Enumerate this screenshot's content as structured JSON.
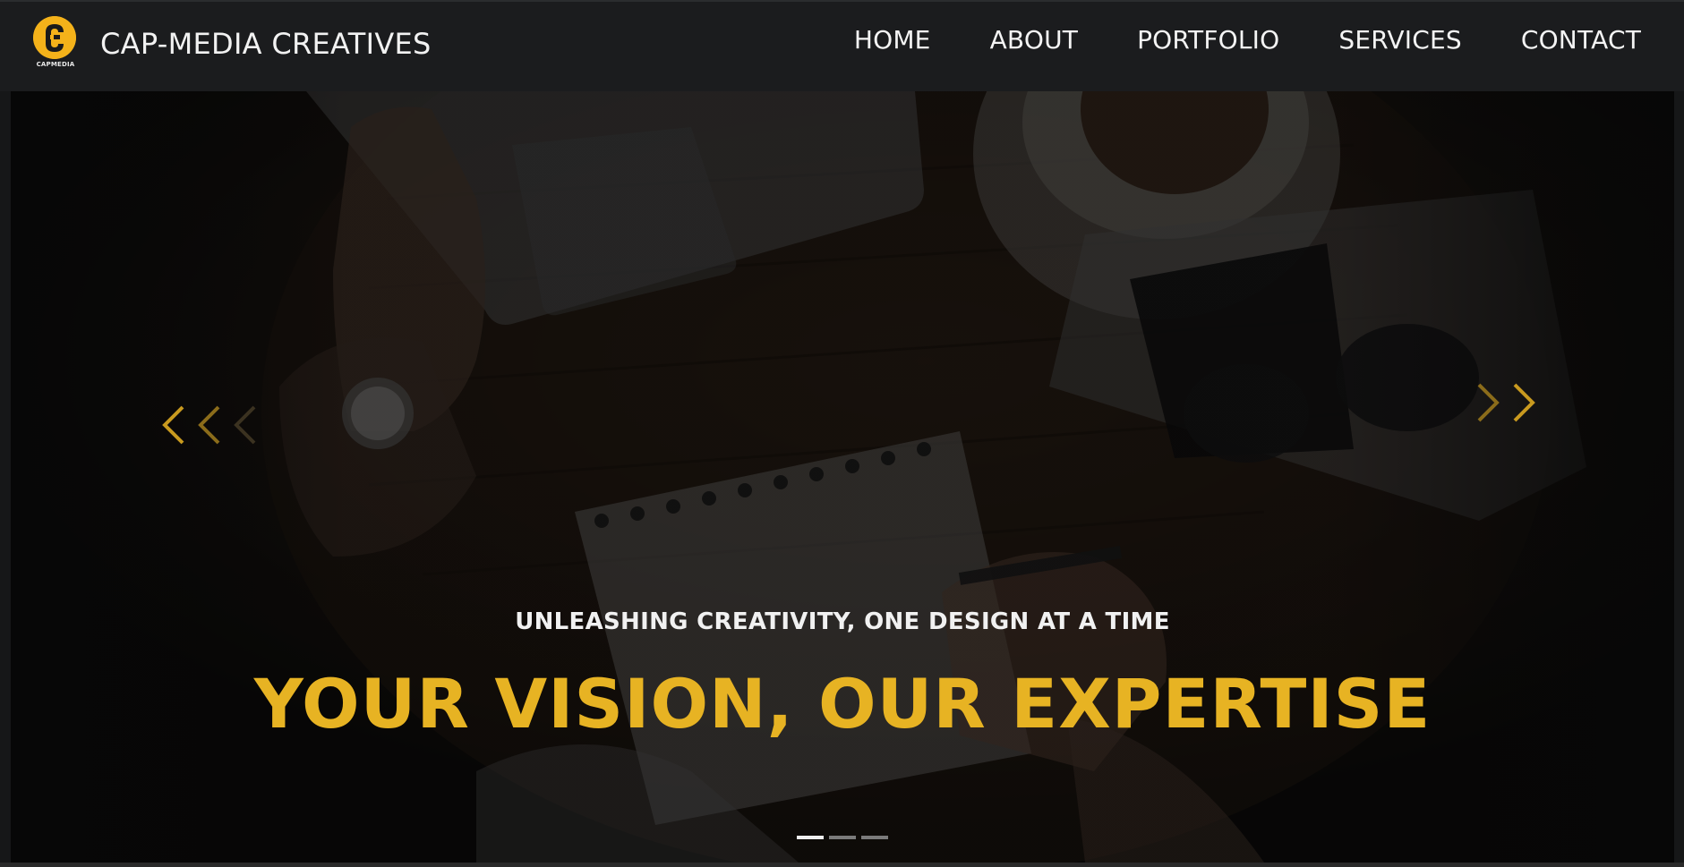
{
  "header": {
    "logo_text": "CAPMEDIA",
    "brand": "CAP-MEDIA CREATIVES",
    "nav": [
      {
        "label": "HOME"
      },
      {
        "label": "ABOUT"
      },
      {
        "label": "PORTFOLIO"
      },
      {
        "label": "SERVICES"
      },
      {
        "label": "CONTACT"
      }
    ]
  },
  "hero": {
    "subheading": "UNLEASHING CREATIVITY, ONE DESIGN AT A TIME",
    "heading": "YOUR VISION, OUR EXPERTISE",
    "slides_total": 3,
    "active_slide": 1
  },
  "colors": {
    "accent": "#e7b323",
    "header_bg": "#1b1c1e",
    "text": "#f2f2f2"
  },
  "icons": {
    "prev": "chevron-left-icon",
    "next": "chevron-right-icon",
    "logo": "cap-media-logo"
  }
}
